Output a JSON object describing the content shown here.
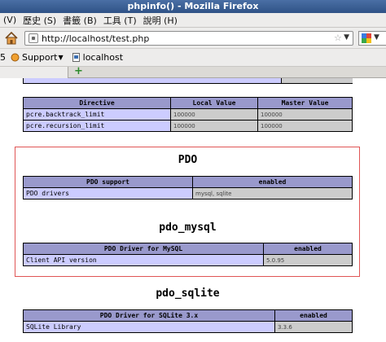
{
  "window": {
    "title": "phpinfo() - Mozilla Firefox"
  },
  "menu": [
    "(V)",
    "歷史 (S)",
    "書籤 (B)",
    "工具 (T)",
    "說明 (H)"
  ],
  "navbar": {
    "url": "http://localhost/test.php",
    "dropdown_glyph": "▼",
    "star_glyph": "☆",
    "home_icon": "home-icon",
    "search_engine_icon": "google-icon"
  },
  "bookmarks": [
    {
      "label": "Support",
      "has_dropdown": true,
      "icon": "support-icon"
    },
    {
      "label": "localhost",
      "has_dropdown": false,
      "icon": "page-icon"
    }
  ],
  "bookmarks_prefix": "5",
  "tabs": {
    "new_tab_glyph": "+"
  },
  "content": {
    "directive_table": {
      "headers": [
        "Directive",
        "Local Value",
        "Master Value"
      ],
      "rows": [
        [
          "pcre.backtrack_limit",
          "100000",
          "100000"
        ],
        [
          "pcre.recursion_limit",
          "100000",
          "100000"
        ]
      ]
    },
    "pdo": {
      "title": "PDO",
      "headers": [
        "PDO support",
        "enabled"
      ],
      "rows": [
        [
          "PDO drivers",
          "mysql, sqlite"
        ]
      ]
    },
    "pdo_mysql": {
      "title": "pdo_mysql",
      "headers": [
        "PDO Driver for MySQL",
        "enabled"
      ],
      "rows": [
        [
          "Client API version",
          "5.0.95"
        ]
      ]
    },
    "pdo_sqlite": {
      "title": "pdo_sqlite",
      "headers": [
        "PDO Driver for SQLite 3.x",
        "enabled"
      ],
      "rows": [
        [
          "SQLite Library",
          "3.3.6"
        ]
      ]
    }
  },
  "colors": {
    "table_header": "#9999cc",
    "table_key": "#ccccff",
    "table_value": "#cccccc",
    "highlight_border": "#e05555"
  }
}
